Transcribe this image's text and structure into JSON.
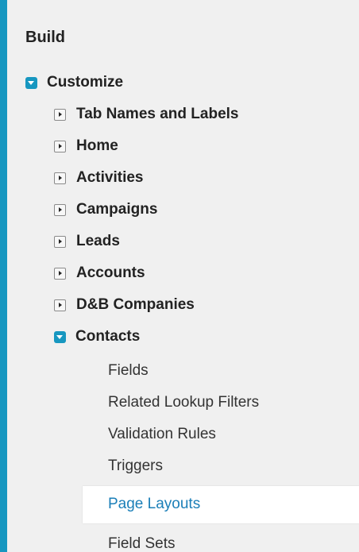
{
  "section_title": "Build",
  "customize": {
    "label": "Customize",
    "icon": "expanded-toggle-icon"
  },
  "objects": [
    {
      "label": "Tab Names and Labels"
    },
    {
      "label": "Home"
    },
    {
      "label": "Activities"
    },
    {
      "label": "Campaigns"
    },
    {
      "label": "Leads"
    },
    {
      "label": "Accounts"
    },
    {
      "label": "D&B Companies"
    }
  ],
  "contacts": {
    "label": "Contacts",
    "children": [
      {
        "label": "Fields"
      },
      {
        "label": "Related Lookup Filters"
      },
      {
        "label": "Validation Rules"
      },
      {
        "label": "Triggers"
      }
    ],
    "selected": {
      "label": "Page Layouts"
    },
    "after_selected": [
      {
        "label": "Field Sets"
      }
    ]
  },
  "colors": {
    "accent": "#1797c0",
    "selected_text": "#1b7fb8"
  }
}
